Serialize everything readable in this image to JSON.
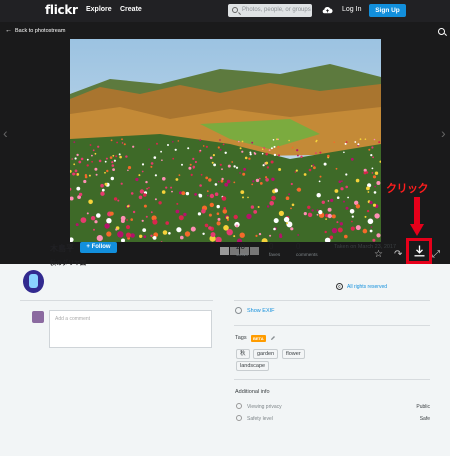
{
  "header": {
    "logo": "flickr",
    "nav": [
      "Explore",
      "Create"
    ],
    "search_placeholder": "Photos, people, or groups",
    "login_label": "Log In",
    "signup_label": "Sign Up"
  },
  "viewer": {
    "back_label": "Back to photostream",
    "annotation": "クリック"
  },
  "photo_owner": {
    "name": "木島平",
    "follow_label": "+ Follow",
    "album_title": "秋のダリヤ園"
  },
  "comment": {
    "placeholder": "Add a comment"
  },
  "stats": [
    {
      "value": "20",
      "label": "views"
    },
    {
      "value": "0",
      "label": "faves"
    },
    {
      "value": "0",
      "label": "comments"
    }
  ],
  "meta": {
    "taken": "Taken on March 23, 2017",
    "rights": "All rights reserved",
    "rights_icon": "©"
  },
  "exif_label": "Show EXIF",
  "tags": {
    "title": "Tags",
    "beta": "BETA",
    "items": [
      "秋",
      "garden",
      "flower",
      "landscape"
    ]
  },
  "additional_info": {
    "title": "Additional info",
    "rows": [
      {
        "label": "Viewing privacy",
        "value": "Public"
      },
      {
        "label": "Safety level",
        "value": "Safe"
      }
    ]
  },
  "colors": {
    "brand_blue": "#128fdc",
    "annotation_red": "#e6001a",
    "dark_bg": "#212124"
  }
}
